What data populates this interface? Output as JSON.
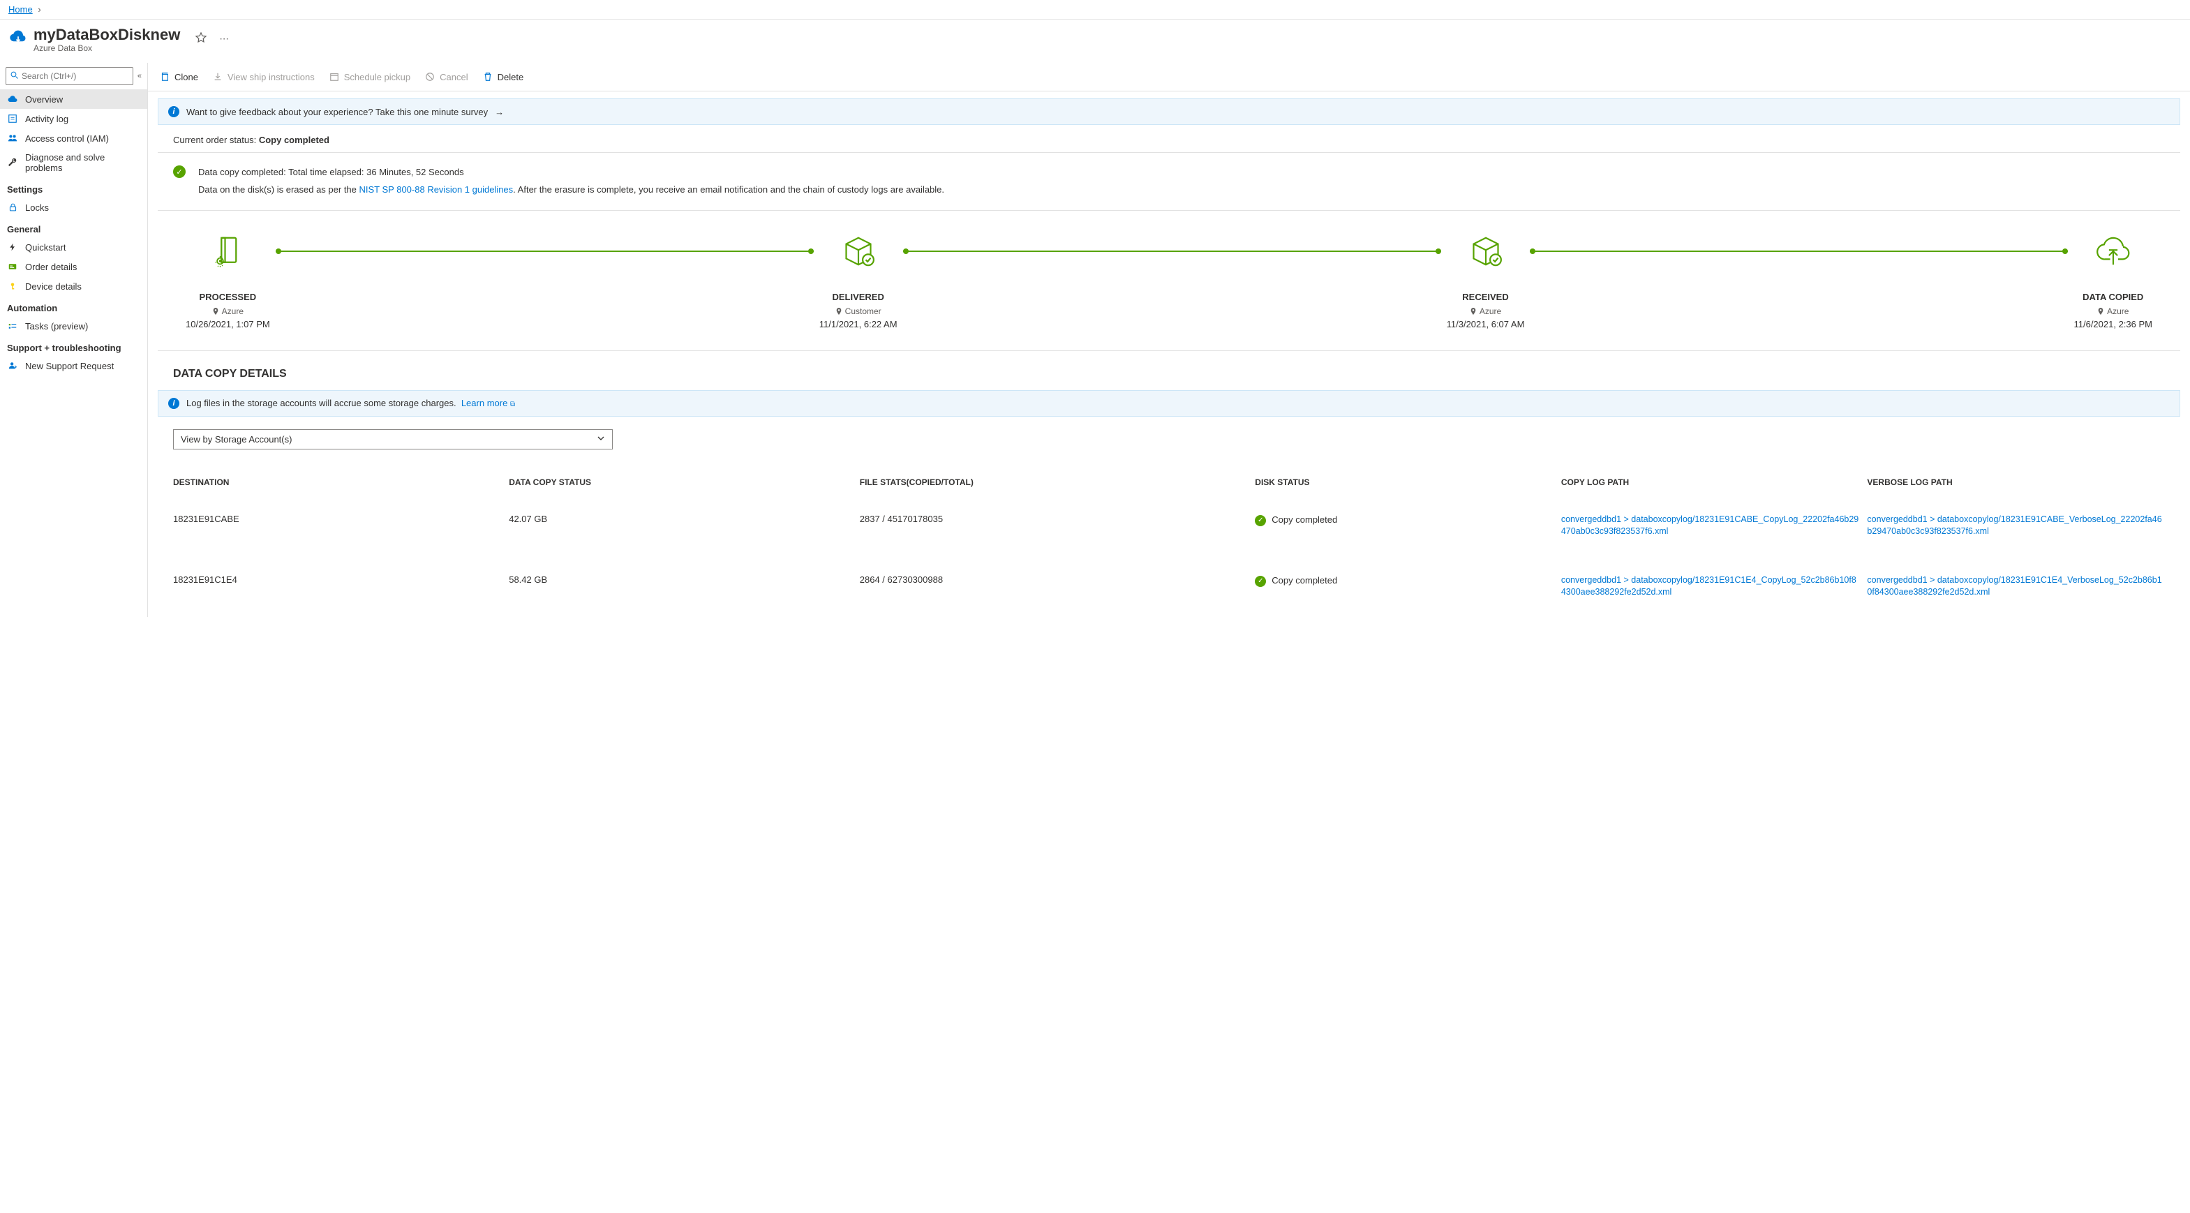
{
  "breadcrumb": {
    "home": "Home"
  },
  "header": {
    "title": "myDataBoxDisknew",
    "subtitle": "Azure Data Box"
  },
  "search": {
    "placeholder": "Search (Ctrl+/)"
  },
  "nav": {
    "overview": "Overview",
    "activity_log": "Activity log",
    "access_control": "Access control (IAM)",
    "diagnose": "Diagnose and solve problems",
    "heading_settings": "Settings",
    "locks": "Locks",
    "heading_general": "General",
    "quickstart": "Quickstart",
    "order_details": "Order details",
    "device_details": "Device details",
    "heading_automation": "Automation",
    "tasks": "Tasks (preview)",
    "heading_support": "Support + troubleshooting",
    "new_support": "New Support Request"
  },
  "toolbar": {
    "clone": "Clone",
    "view_ship": "View ship instructions",
    "schedule": "Schedule pickup",
    "cancel": "Cancel",
    "delete": "Delete"
  },
  "feedback": {
    "text": "Want to give feedback about your experience? Take this one minute survey"
  },
  "order_status": {
    "label": "Current order status:",
    "value": "Copy completed"
  },
  "success": {
    "line1": "Data copy completed: Total time elapsed: 36 Minutes, 52 Seconds",
    "line2a": "Data on the disk(s) is erased as per the ",
    "line2link": "NIST SP 800-88 Revision 1 guidelines",
    "line2b": ". After the erasure is complete, you receive an email notification and the chain of custody logs are available."
  },
  "stages": {
    "processed": {
      "label": "PROCESSED",
      "sub": "Azure",
      "time": "10/26/2021, 1:07 PM"
    },
    "delivered": {
      "label": "DELIVERED",
      "sub": "Customer",
      "time": "11/1/2021, 6:22 AM"
    },
    "received": {
      "label": "RECEIVED",
      "sub": "Azure",
      "time": "11/3/2021, 6:07 AM"
    },
    "copied": {
      "label": "DATA COPIED",
      "sub": "Azure",
      "time": "11/6/2021, 2:36 PM"
    }
  },
  "data_copy": {
    "title": "DATA COPY DETAILS",
    "info": "Log files in the storage accounts will accrue some storage charges.",
    "learn_more": "Learn more",
    "select_label": "View by Storage Account(s)",
    "headers": {
      "dest": "DESTINATION",
      "status": "DATA COPY STATUS",
      "file_stats": "FILE STATS(COPIED/TOTAL)",
      "disk_status": "DISK STATUS",
      "copy_log": "COPY LOG PATH",
      "verbose_log": "VERBOSE LOG PATH"
    },
    "rows": [
      {
        "dest": "18231E91CABE",
        "status": "42.07 GB",
        "file_stats": "2837 / 45170178035",
        "disk_status": "Copy completed",
        "copy_log": "convergeddbd1 > databoxcopylog/18231E91CABE_CopyLog_22202fa46b29470ab0c3c93f823537f6.xml",
        "verbose_log": "convergeddbd1 > databoxcopylog/18231E91CABE_VerboseLog_22202fa46b29470ab0c3c93f823537f6.xml"
      },
      {
        "dest": "18231E91C1E4",
        "status": "58.42 GB",
        "file_stats": "2864 / 62730300988",
        "disk_status": "Copy completed",
        "copy_log": "convergeddbd1 > databoxcopylog/18231E91C1E4_CopyLog_52c2b86b10f84300aee388292fe2d52d.xml",
        "verbose_log": "convergeddbd1 > databoxcopylog/18231E91C1E4_VerboseLog_52c2b86b10f84300aee388292fe2d52d.xml"
      }
    ]
  }
}
